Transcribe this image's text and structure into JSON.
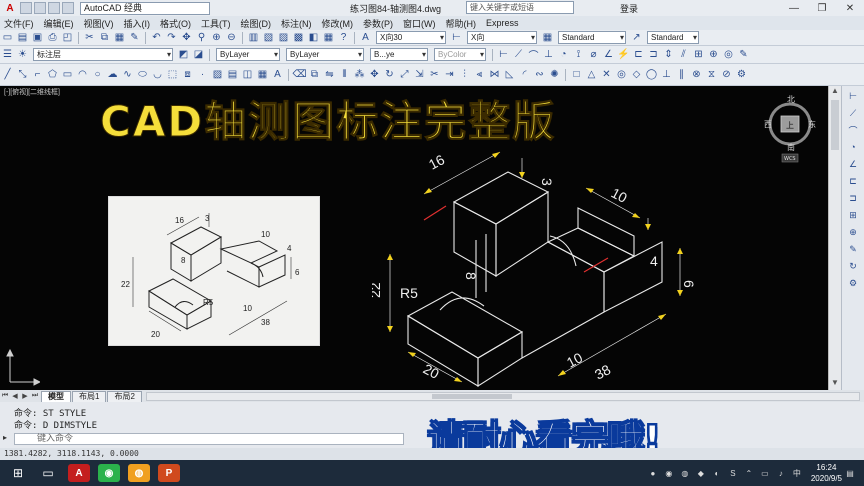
{
  "titlebar": {
    "workspace": "AutoCAD 经典",
    "document": "练习图84-轴测图4.dwg",
    "search_placeholder": "键入关键字或短语",
    "login": "登录"
  },
  "menu": [
    "文件(F)",
    "编辑(E)",
    "视图(V)",
    "插入(I)",
    "格式(O)",
    "工具(T)",
    "绘图(D)",
    "标注(N)",
    "修改(M)",
    "参数(P)",
    "窗口(W)",
    "帮助(H)",
    "Express"
  ],
  "toolbar1": {
    "dim_style_a": "X向30",
    "dim_style_b": "X向",
    "text_style": "Standard",
    "table_style": "Standard"
  },
  "toolbar2": {
    "layer": "标注层",
    "color": "ByLayer",
    "linetype": "ByLayer",
    "lineweight": "B...ye",
    "plotstyle": "ByColor"
  },
  "viewport": {
    "view_label": "[-][俯视][二维线框]",
    "banner": "CAD轴测图标注完整版"
  },
  "compass": {
    "north": "北",
    "south": "南",
    "east": "东",
    "west": "西",
    "center": "上",
    "wcs": "WCS"
  },
  "drawing_dims": {
    "d16": "16",
    "d3": "3",
    "d10a": "10",
    "d4": "4",
    "d6": "6",
    "d10b": "10",
    "d38": "38",
    "d20": "20",
    "d22": "22",
    "d8": "8",
    "r5": "R5"
  },
  "tabs": [
    "模型",
    "布局1",
    "布局2"
  ],
  "command": {
    "line1": "命令: ST STYLE",
    "line2": "命令: D DIMSTYLE",
    "input_placeholder": "键入命令"
  },
  "overlay_text": "请耐心看完哦!",
  "status": {
    "coords": "1381.4282, 3118.1143, 0.0000"
  },
  "taskbar": {
    "time": "16:24",
    "date": "2020/9/5"
  }
}
